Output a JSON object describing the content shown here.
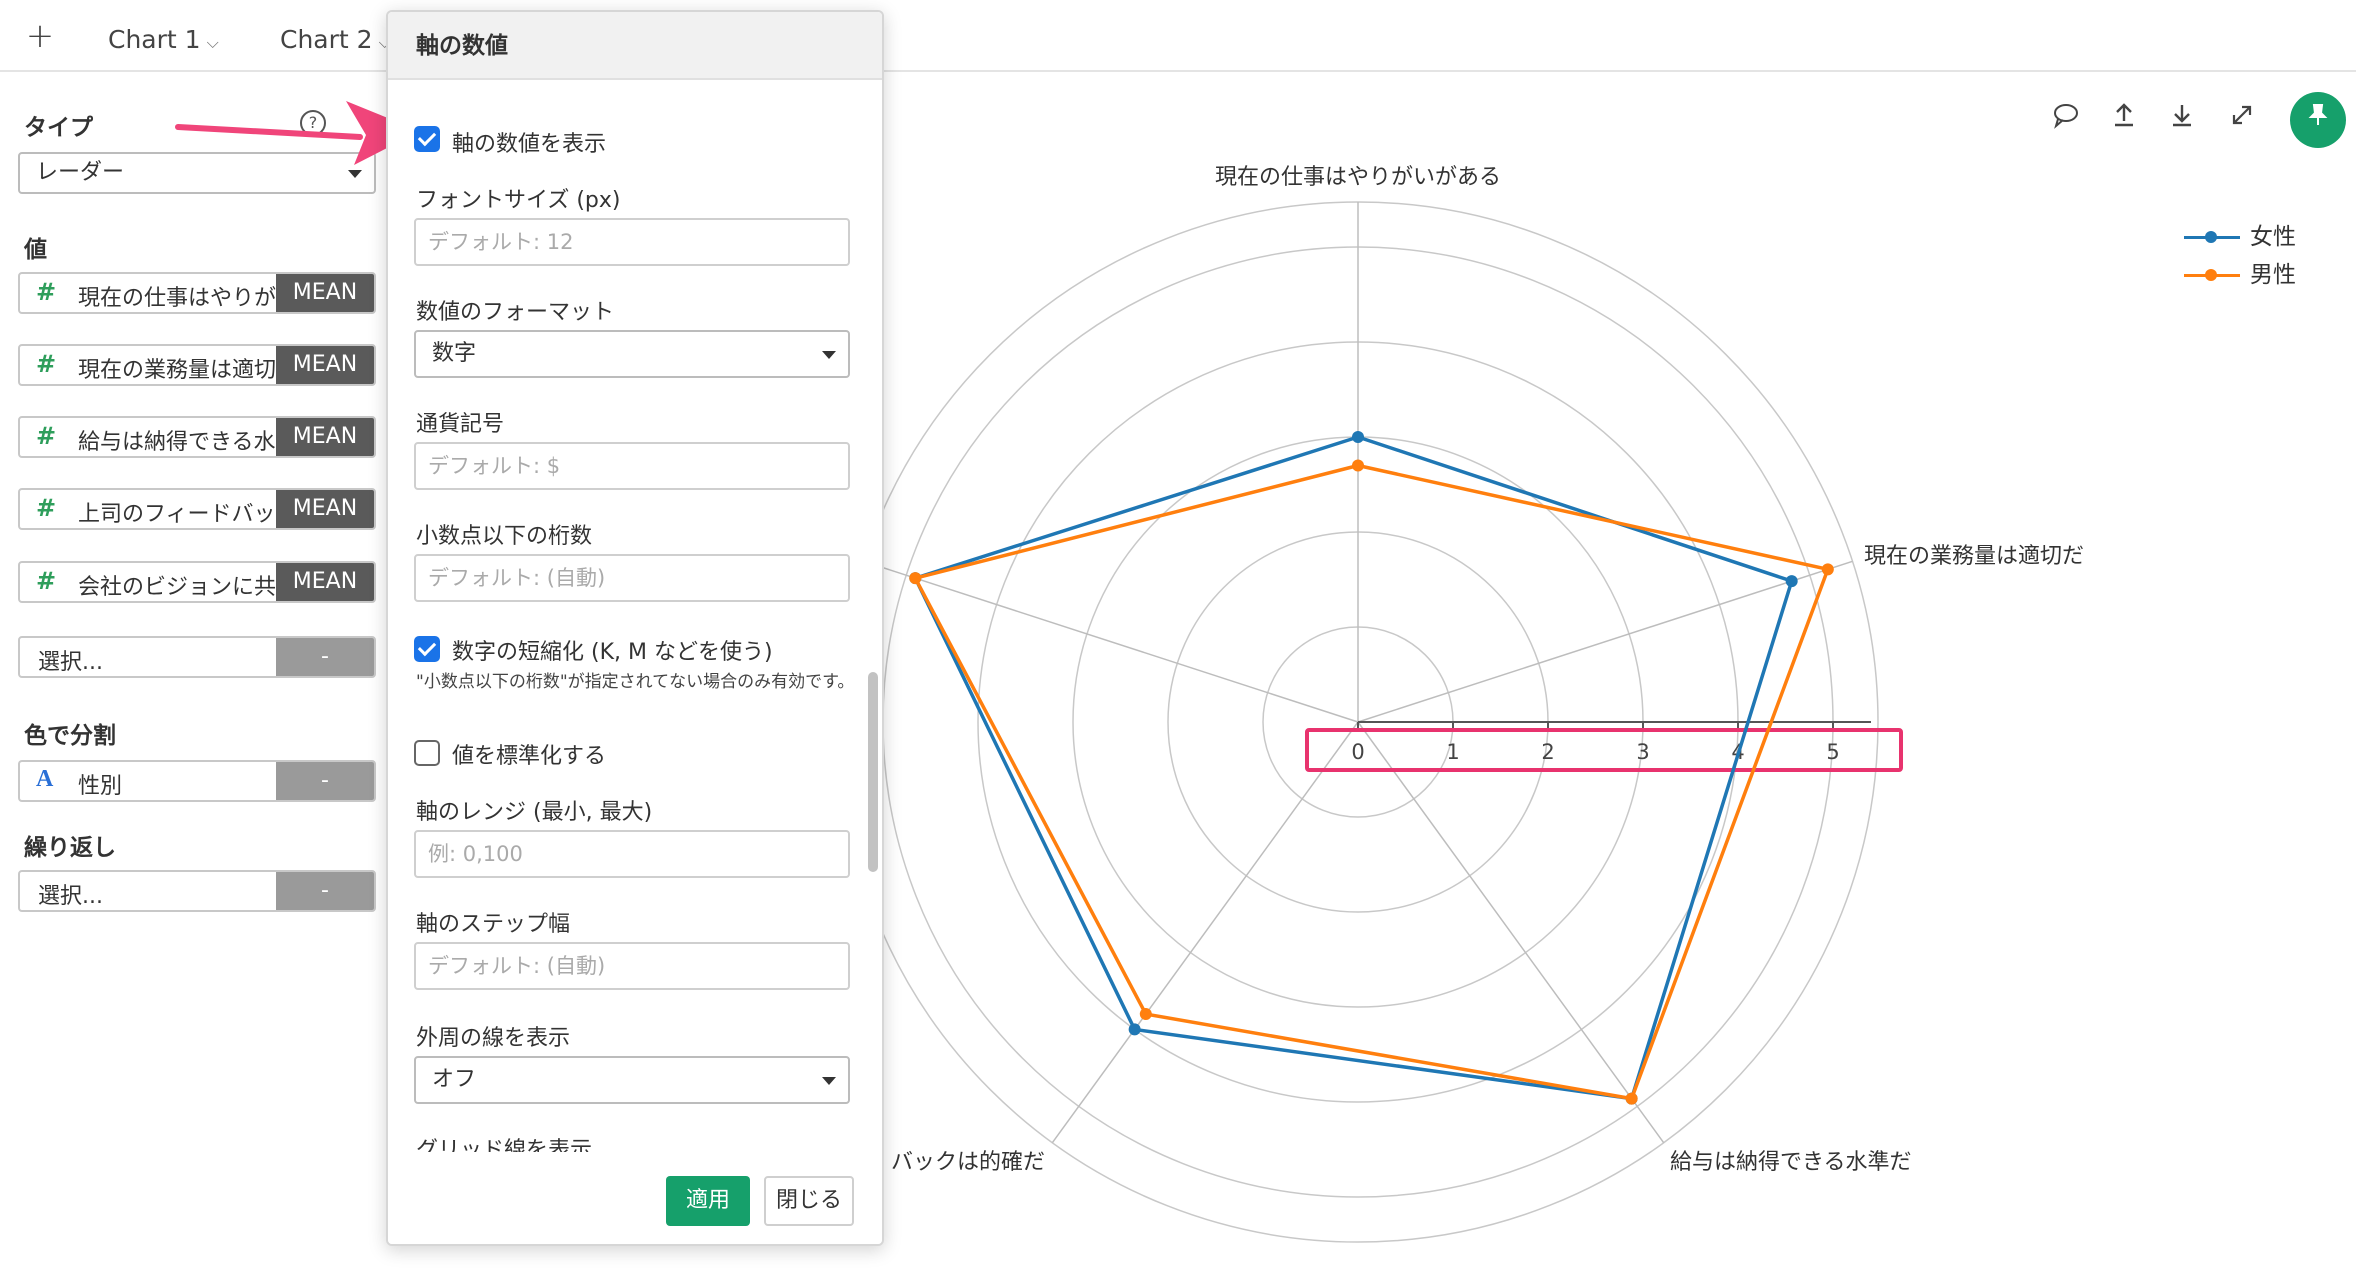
{
  "tabs": {
    "add_icon": "plus-icon",
    "items": [
      {
        "label": "Chart 1",
        "chevron": "⌵"
      },
      {
        "label": "Chart 2",
        "chevron": "⌵"
      }
    ]
  },
  "sidebar": {
    "type_label": "タイプ",
    "type_value": "レーダー",
    "values_label": "値",
    "values": [
      {
        "name": "現在の仕事はやりが",
        "agg": "MEAN"
      },
      {
        "name": "現在の業務量は適切",
        "agg": "MEAN"
      },
      {
        "name": "給与は納得できる水",
        "agg": "MEAN"
      },
      {
        "name": "上司のフィードバッ",
        "agg": "MEAN"
      },
      {
        "name": "会社のビジョンに共",
        "agg": "MEAN"
      }
    ],
    "select_placeholder": "選択...",
    "remove_symbol": "-",
    "color_label": "色で分割",
    "color_field": "性別",
    "repeat_label": "繰り返し"
  },
  "popup": {
    "title": "軸の数値",
    "show_axis_values": "軸の数値を表示",
    "font_size_label": "フォントサイズ (px)",
    "font_size_placeholder": "デフォルト: 12",
    "format_label": "数値のフォーマット",
    "format_value": "数字",
    "currency_label": "通貨記号",
    "currency_placeholder": "デフォルト: $",
    "decimals_label": "小数点以下の桁数",
    "decimals_placeholder": "デフォルト: (自動)",
    "abbreviate_label": "数字の短縮化 (K, M などを使う)",
    "abbreviate_note": "\"小数点以下の桁数\"が指定されてない場合のみ有効です。",
    "normalize_label": "値を標準化する",
    "range_label": "軸のレンジ (最小, 最大)",
    "range_placeholder": "例: 0,100",
    "step_label": "軸のステップ幅",
    "step_placeholder": "デフォルト: (自動)",
    "outer_line_label": "外周の線を表示",
    "outer_line_value": "オフ",
    "grid_label": "グリッド線を表示",
    "apply": "適用",
    "close": "閉じる"
  },
  "chart_data": {
    "type": "radar",
    "axes": [
      "現在の仕事はやりがいがある",
      "現在の業務量は適切だ",
      "給与は納得できる水準だ",
      "上司のフィードバックは的確だ",
      "会社のビジョンに共感できる"
    ],
    "axis_labels_visible": [
      "現在の仕事はやりがいがある",
      "現在の業務量は適切だ",
      "給与は納得できる水準だ",
      "バックは的確だ",
      ""
    ],
    "ticks": [
      "0",
      "1",
      "2",
      "3",
      "4",
      "5"
    ],
    "range": [
      0,
      5
    ],
    "series": [
      {
        "name": "女性",
        "color": "#1f77b4",
        "values": [
          3.0,
          4.8,
          4.9,
          4.0,
          4.9
        ]
      },
      {
        "name": "男性",
        "color": "#ff7f0e",
        "values": [
          2.7,
          5.2,
          4.9,
          3.8,
          4.9
        ]
      }
    ],
    "grid": "circular",
    "legend": "top-right"
  },
  "colors": {
    "accent": "#16a06b",
    "highlight": "#e8336e",
    "checkbox": "#1a73e8"
  },
  "toolbar_icons": [
    "comment-icon",
    "upload-icon",
    "download-icon",
    "expand-icon",
    "pin-icon"
  ]
}
